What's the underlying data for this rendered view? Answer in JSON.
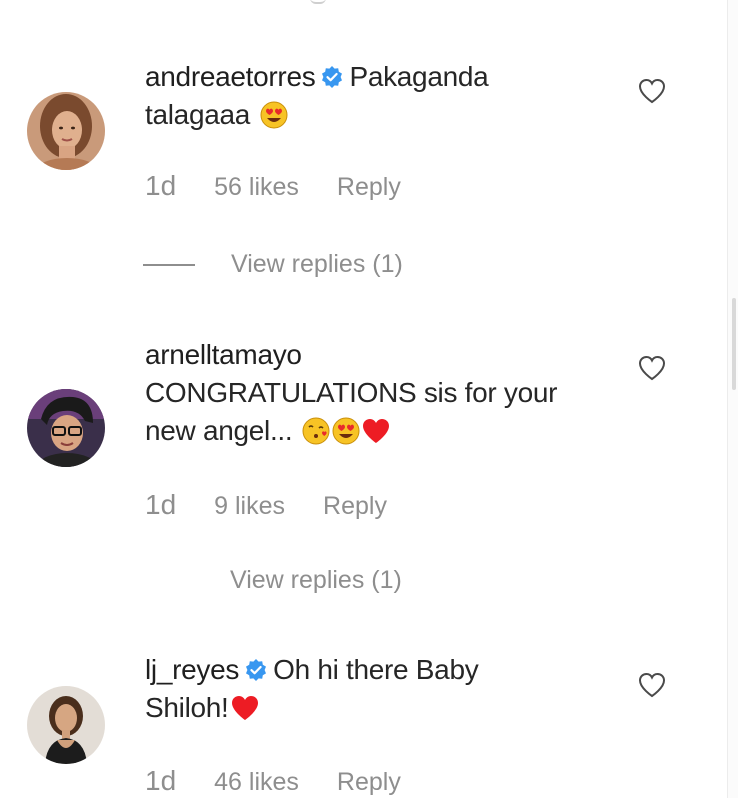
{
  "comments": [
    {
      "username": "andreaetorres",
      "verified": true,
      "text_line1": "Pakaganda",
      "text_line2": "talagaaa",
      "emojis": [
        "heart-eyes-emoji"
      ],
      "time": "1d",
      "likes": "56 likes",
      "reply_label": "Reply",
      "view_replies": "View replies (1)"
    },
    {
      "username": "arnelltamayo",
      "verified": false,
      "text_line1": "CONGRATULATIONS sis for your",
      "text_line2": "new angel...",
      "emojis": [
        "kissing-emoji",
        "heart-eyes-emoji",
        "red-heart-emoji"
      ],
      "time": "1d",
      "likes": "9 likes",
      "reply_label": "Reply",
      "view_replies": "View replies (1)"
    },
    {
      "username": "lj_reyes",
      "verified": true,
      "text_line1": "Oh hi there Baby",
      "text_line2": "Shiloh!",
      "emojis": [
        "red-heart-emoji"
      ],
      "time": "1d",
      "likes": "46 likes",
      "reply_label": "Reply"
    }
  ],
  "colors": {
    "text": "#262626",
    "muted": "#8e8e8e",
    "verified_badge": "#3897f0",
    "heart_emoji": "#ed1c24"
  }
}
